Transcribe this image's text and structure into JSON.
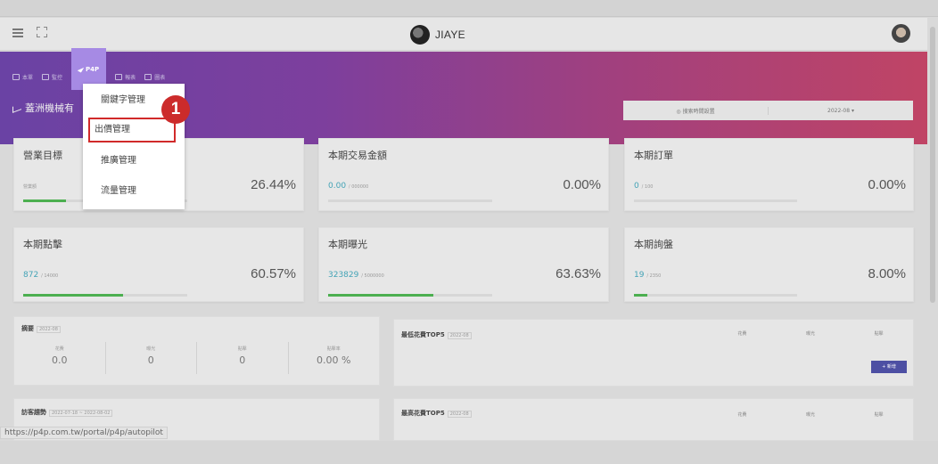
{
  "brand": {
    "name": "JIAYE"
  },
  "subnav": {
    "items": [
      {
        "label": "本單"
      },
      {
        "label": "監控"
      },
      {
        "label": "P4P"
      },
      {
        "label": "報表"
      },
      {
        "label": "圖表"
      }
    ]
  },
  "page_heading": "蓋洲機械有",
  "filter": {
    "settings_label": "◎ 搜索時間設置",
    "month": "2022-08"
  },
  "dropdown": {
    "items": [
      "關鍵字管理",
      "出價管理",
      "推廣管理",
      "流量管理"
    ],
    "highlighted": "出價管理",
    "step_number": "1"
  },
  "cards": [
    {
      "title": "營業目標",
      "sub": "",
      "sub_small": "營業額",
      "pct": "26.44%",
      "progress": 0.26
    },
    {
      "title": "本期交易金額",
      "sub": "0.00",
      "sub_small": "/ 000000",
      "pct": "0.00%",
      "progress": 0
    },
    {
      "title": "本期訂單",
      "sub": "0",
      "sub_small": "/ 100",
      "pct": "0.00%",
      "progress": 0
    },
    {
      "title": "本期點擊",
      "sub": "872",
      "sub_small": "/ 14000",
      "pct": "60.57%",
      "progress": 0.61
    },
    {
      "title": "本期曝光",
      "sub": "323829",
      "sub_small": "/ 5000000",
      "pct": "63.63%",
      "progress": 0.64
    },
    {
      "title": "本期詢盤",
      "sub": "19",
      "sub_small": "/ 2350",
      "pct": "8.00%",
      "progress": 0.08
    }
  ],
  "summary": {
    "title": "摘要",
    "tag": "2022-08",
    "cols": [
      {
        "label": "花費",
        "value": "0.0"
      },
      {
        "label": "曝光",
        "value": "0"
      },
      {
        "label": "點擊",
        "value": "0"
      },
      {
        "label": "點擊率",
        "value": "0.00 %"
      }
    ]
  },
  "trend": {
    "title": "訪客趨勢",
    "tag": "2022-07-18 ~ 2022-08-02"
  },
  "top5_a": {
    "title": "最低花費TOP5",
    "tag": "2022-08",
    "cols": [
      "花費",
      "曝光",
      "點擊"
    ],
    "button": "+ 新增"
  },
  "top5_b": {
    "title": "最高花費TOP5",
    "tag": "2022-08",
    "cols": [
      "花費",
      "曝光",
      "點擊"
    ]
  },
  "status_url": "https://p4p.com.tw/portal/p4p/autopilot"
}
